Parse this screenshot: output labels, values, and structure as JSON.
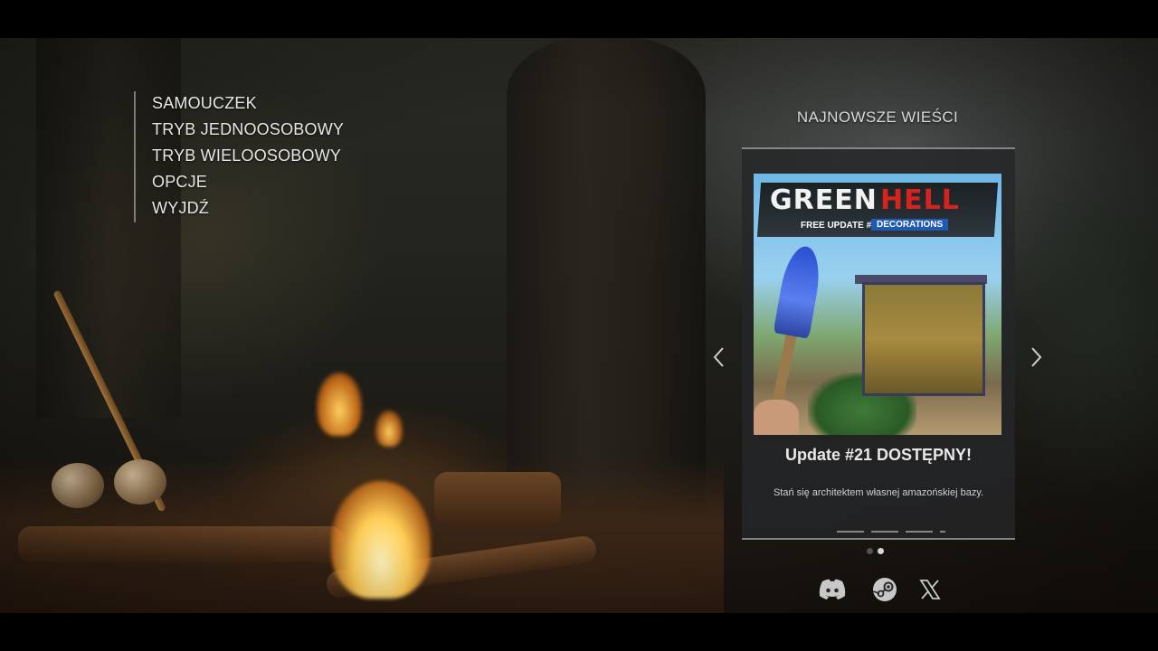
{
  "menu": {
    "items": [
      {
        "label": "SAMOUCZEK"
      },
      {
        "label": "TRYB JEDNOOSOBOWY"
      },
      {
        "label": "TRYB WIELOOSOBOWY"
      },
      {
        "label": "OPCJE"
      },
      {
        "label": "WYJDŹ"
      }
    ]
  },
  "news": {
    "section_title": "NAJNOWSZE WIEŚCI",
    "image": {
      "logo_word1": "GREEN",
      "logo_word2": "HELL",
      "subtitle1": "FREE UPDATE #21",
      "subtitle2": "DECORATIONS"
    },
    "headline": "Update #21 DOSTĘPNY!",
    "body": "Stań się architektem własnej amazońskiej bazy.",
    "prev_icon": "chevron-left-icon",
    "next_icon": "chevron-right-icon",
    "page_indicator": {
      "count": 2,
      "active": 1
    }
  },
  "social": [
    {
      "icon": "discord-icon"
    },
    {
      "icon": "steam-icon"
    },
    {
      "icon": "x-icon"
    }
  ],
  "colors": {
    "text": "#e6e6e6",
    "panel": "#242628",
    "logo_red": "#d8221c",
    "accent_blue": "#1f5bb5"
  }
}
